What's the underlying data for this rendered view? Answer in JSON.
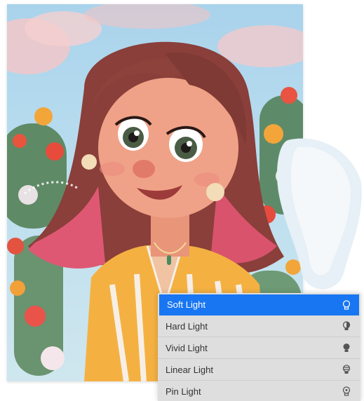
{
  "artwork": {
    "subject": "illustrated girl portrait with flowers and cacti"
  },
  "blend_menu": {
    "items": [
      {
        "label": "Soft Light",
        "icon": "soft-light-bulb-icon",
        "selected": true
      },
      {
        "label": "Hard Light",
        "icon": "hard-light-bulb-icon",
        "selected": false
      },
      {
        "label": "Vivid Light",
        "icon": "vivid-light-bulb-icon",
        "selected": false
      },
      {
        "label": "Linear Light",
        "icon": "linear-light-bulb-icon",
        "selected": false
      },
      {
        "label": "Pin Light",
        "icon": "pin-light-bulb-icon",
        "selected": false
      }
    ],
    "accent_color": "#1876f2"
  }
}
